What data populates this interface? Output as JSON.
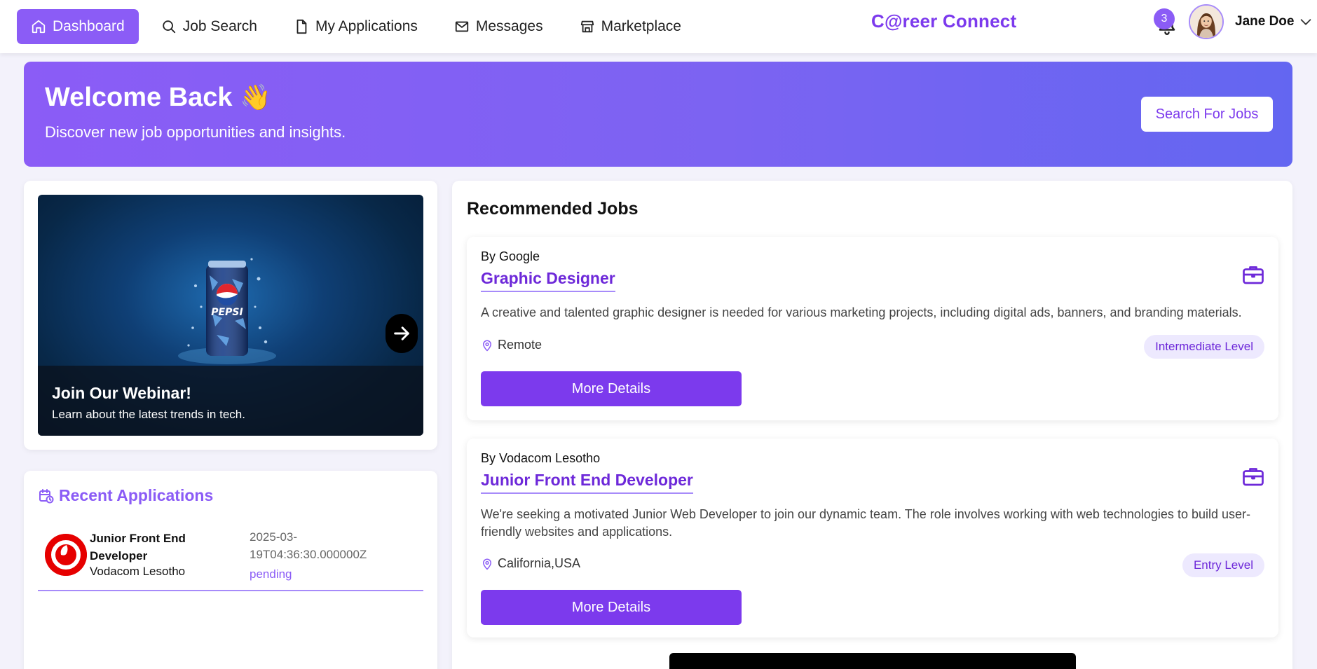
{
  "nav": {
    "items": [
      {
        "label": "Dashboard",
        "icon": "home-icon",
        "active": true
      },
      {
        "label": "Job Search",
        "icon": "search-icon",
        "active": false
      },
      {
        "label": "My Applications",
        "icon": "document-icon",
        "active": false
      },
      {
        "label": "Messages",
        "icon": "mail-icon",
        "active": false
      },
      {
        "label": "Marketplace",
        "icon": "store-icon",
        "active": false
      }
    ],
    "brand": "C@reer Connect",
    "notification_count": "3",
    "user_name": "Jane Doe"
  },
  "hero": {
    "title": "Welcome Back",
    "emoji": "👋",
    "subtitle": "Discover new job opportunities and insights.",
    "button_label": "Search For Jobs"
  },
  "webinar": {
    "title": "Join Our Webinar!",
    "subtitle": "Learn about the latest trends in tech.",
    "image_text": "PEPSI"
  },
  "recent_applications": {
    "heading": "Recent Applications",
    "items": [
      {
        "title": "Junior Front End Developer",
        "company": "Vodacom Lesotho",
        "date": "2025-03-19T04:36:30.000000Z",
        "status": "pending"
      }
    ]
  },
  "recommended_jobs": {
    "heading": "Recommended Jobs",
    "items": [
      {
        "company": "By Google",
        "title": "Graphic Designer",
        "description": "A creative and talented graphic designer is needed for various marketing projects, including digital ads, banners, and branding materials.",
        "location": "Remote",
        "level": "Intermediate Level",
        "button_label": "More Details"
      },
      {
        "company": "By Vodacom Lesotho",
        "title": "Junior Front End Developer",
        "description": "We're seeking a motivated Junior Web Developer to join our dynamic team. The role involves working with web technologies to build user-friendly websites and applications.",
        "location": "California,USA",
        "level": "Entry Level",
        "button_label": "More Details"
      }
    ]
  },
  "colors": {
    "accent": "#8b5cf6",
    "accent_dark": "#7c3aed",
    "brand": "#7c3aed",
    "hero_gradient_end": "#6366f1",
    "vodafone_red": "#e60000"
  }
}
